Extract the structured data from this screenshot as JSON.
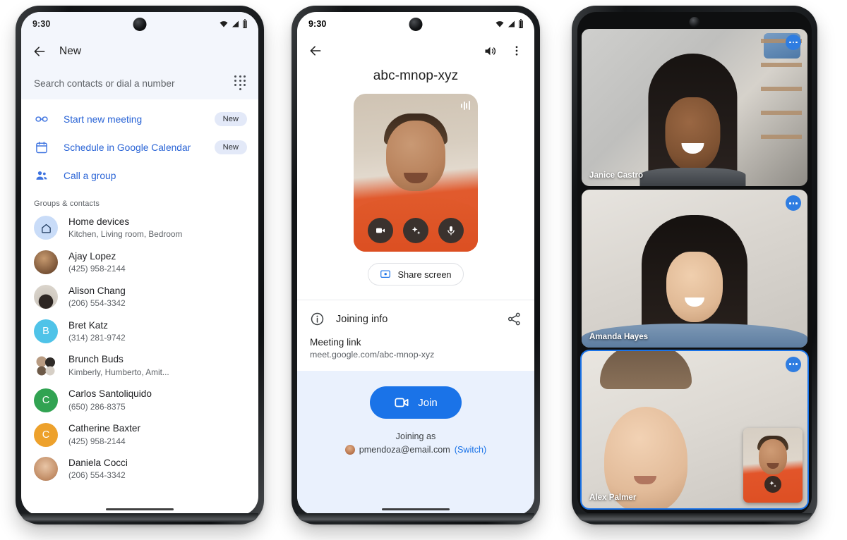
{
  "phone1": {
    "status": {
      "time": "9:30",
      "wifi_icon": "wifi-icon",
      "signal_icon": "signal-icon",
      "battery_icon": "battery-icon"
    },
    "appbar": {
      "back_icon": "back-arrow-icon",
      "title": "New"
    },
    "search": {
      "placeholder": "Search contacts or dial a number",
      "dialpad_icon": "dialpad-icon"
    },
    "quick_actions": [
      {
        "icon": "link-icon",
        "label": "Start new meeting",
        "badge": "New"
      },
      {
        "icon": "calendar-icon",
        "label": "Schedule in Google Calendar",
        "badge": "New"
      },
      {
        "icon": "group-icon",
        "label": "Call a group",
        "badge": ""
      }
    ],
    "section_title": "Groups & contacts",
    "contacts": [
      {
        "name": "Home devices",
        "sub": "Kitchen, Living room, Bedroom",
        "avatar_type": "home",
        "avatar_color": "#c9dcf8",
        "initial": ""
      },
      {
        "name": "Ajay Lopez",
        "sub": "(425) 958-2144",
        "avatar_type": "photo",
        "avatar_color": "#8b6b4f",
        "initial": ""
      },
      {
        "name": "Alison Chang",
        "sub": "(206) 554-3342",
        "avatar_type": "photo",
        "avatar_color": "#c8c3ba",
        "initial": ""
      },
      {
        "name": "Bret Katz",
        "sub": "(314) 281-9742",
        "avatar_type": "letter",
        "avatar_color": "#4fc3e8",
        "initial": "B"
      },
      {
        "name": "Brunch Buds",
        "sub": "Kimberly, Humberto, Amit...",
        "avatar_type": "group",
        "avatar_color": "#dcd6cd",
        "initial": ""
      },
      {
        "name": "Carlos Santoliquido",
        "sub": "(650) 286-8375",
        "avatar_type": "letter",
        "avatar_color": "#31a352",
        "initial": "C"
      },
      {
        "name": "Catherine Baxter",
        "sub": "(425) 958-2144",
        "avatar_type": "letter",
        "avatar_color": "#eda12c",
        "initial": "C"
      },
      {
        "name": "Daniela Cocci",
        "sub": "(206) 554-3342",
        "avatar_type": "photo",
        "avatar_color": "#d8bfae",
        "initial": ""
      }
    ]
  },
  "phone2": {
    "status": {
      "time": "9:30",
      "wifi_icon": "wifi-icon",
      "signal_icon": "signal-icon",
      "battery_icon": "battery-icon"
    },
    "appbar": {
      "back_icon": "back-arrow-icon",
      "speaker_icon": "speaker-icon",
      "overflow_icon": "more-vertical-icon"
    },
    "meeting_code": "abc-mnop-xyz",
    "selfview_controls": [
      {
        "icon": "camera-icon"
      },
      {
        "icon": "effects-sparkle-icon"
      },
      {
        "icon": "microphone-icon"
      }
    ],
    "share_screen": {
      "icon": "present-screen-icon",
      "label": "Share screen"
    },
    "joining_info": {
      "info_icon": "info-icon",
      "title": "Joining info",
      "share_icon": "share-icon",
      "link_label": "Meeting link",
      "link_value": "meet.google.com/abc-mnop-xyz"
    },
    "join": {
      "icon": "video-camera-icon",
      "label": "Join",
      "joining_as_label": "Joining as",
      "account_email": "pmendoza@email.com",
      "switch_label": "(Switch)",
      "button_color": "#1a73e8"
    }
  },
  "phone3": {
    "tiles": [
      {
        "name": "Janice Castro",
        "more_icon": "more-horizontal-icon",
        "active": false
      },
      {
        "name": "Amanda Hayes",
        "more_icon": "more-horizontal-icon",
        "active": false
      },
      {
        "name": "Alex Palmer",
        "more_icon": "more-horizontal-icon",
        "active": true
      }
    ],
    "self_pip": {
      "effects_icon": "effects-sparkle-icon"
    },
    "active_border_color": "#1a73e8"
  }
}
